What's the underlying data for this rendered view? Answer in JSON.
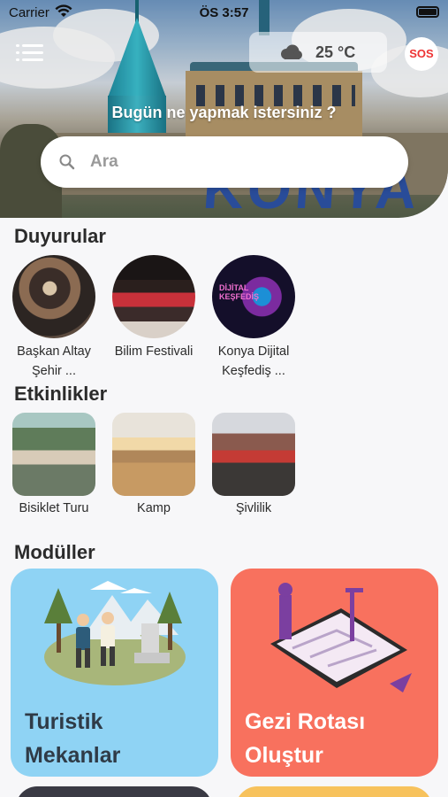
{
  "status_bar": {
    "carrier": "Carrier",
    "time": "ÖS 3:57"
  },
  "header": {
    "weather": {
      "icon": "cloud-icon",
      "temperature": "25 °C"
    },
    "sos_label": "SOS",
    "question": "Bugün ne yapmak istersiniz ?",
    "search": {
      "placeholder": "Ara",
      "value": ""
    },
    "banner_text": "KONYA"
  },
  "announcements": {
    "title": "Duyurular",
    "items": [
      {
        "label_line1": "Başkan Altay",
        "label_line2": "Şehir ..."
      },
      {
        "label_line1": "Bilim Festivali",
        "label_line2": ""
      },
      {
        "label_line1": "Konya Dijital",
        "label_line2": "Keşfediş ...",
        "poster_text": "DİJİTAL KEŞFEDİŞ"
      }
    ]
  },
  "events": {
    "title": "Etkinlikler",
    "items": [
      {
        "label": "Bisiklet Turu"
      },
      {
        "label": "Kamp"
      },
      {
        "label": "Şivlilik"
      }
    ]
  },
  "modules": {
    "title": "Modüller",
    "items": [
      {
        "line1": "Turistik",
        "line2": "Mekanlar",
        "color": "#8fd3f4"
      },
      {
        "line1": "Gezi Rotası",
        "line2": "Oluştur",
        "color": "#f8715e"
      }
    ],
    "partial_colors": [
      "#3a3a44",
      "#f7c25c"
    ]
  }
}
